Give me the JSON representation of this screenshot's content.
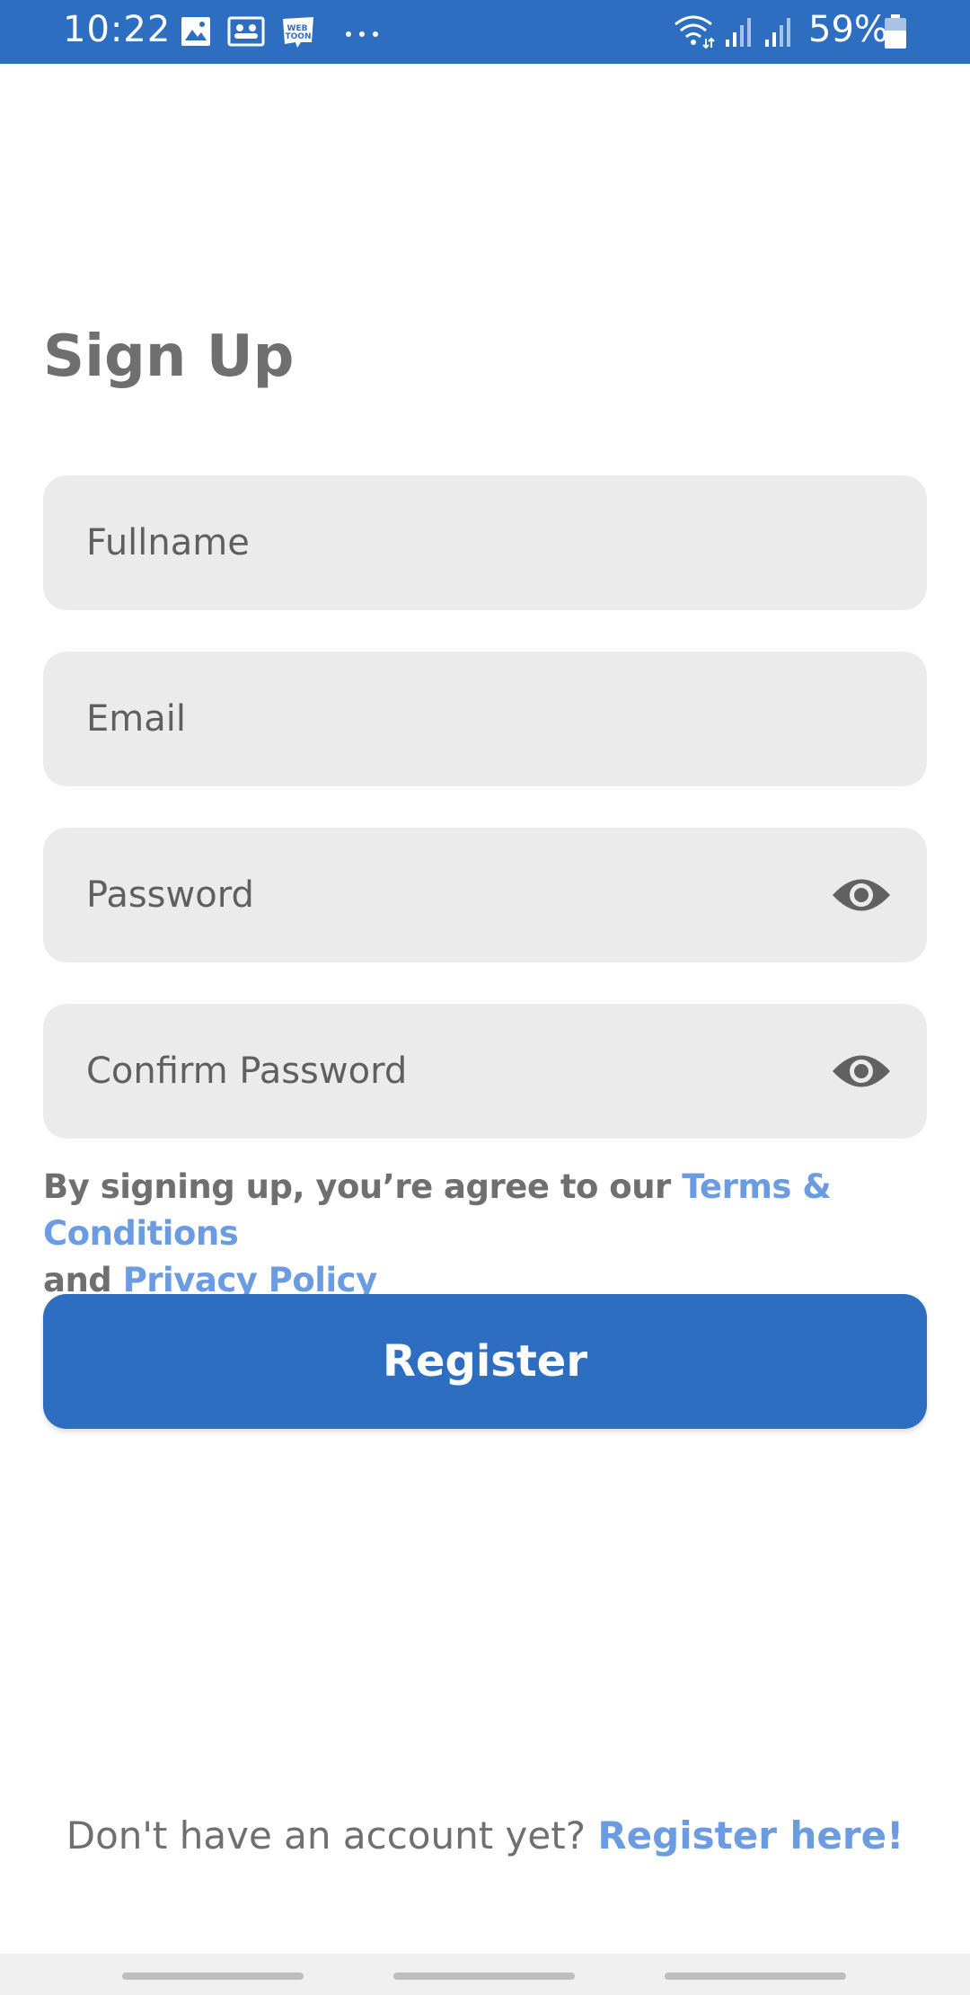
{
  "status_bar": {
    "time": "10:22",
    "battery": "59%",
    "notification_icons": [
      "gallery-icon",
      "group-icon",
      "webtoon-icon",
      "more-dots-icon"
    ],
    "system_icons": [
      "wifi-icon",
      "signal-icon",
      "signal-icon",
      "battery-icon"
    ],
    "webtoon_label": "WEB TOON"
  },
  "page": {
    "title": "Sign Up"
  },
  "form": {
    "fullname_placeholder": "Fullname",
    "email_placeholder": "Email",
    "password_placeholder": "Password",
    "confirm_password_placeholder": "Confirm Password"
  },
  "agreement": {
    "prefix": "By signing up, you’re agree to our ",
    "terms_link": "Terms & Conditions",
    "middle": "and ",
    "privacy_link": "Privacy Policy"
  },
  "register_button": {
    "label": "Register"
  },
  "footer": {
    "prompt": "Don't have an account yet? ",
    "link": "Register here!"
  },
  "colors": {
    "brand": "#2d6ec0",
    "link": "#6b9be0",
    "field_bg": "#ebebeb",
    "text_muted": "#6f6f6f"
  }
}
